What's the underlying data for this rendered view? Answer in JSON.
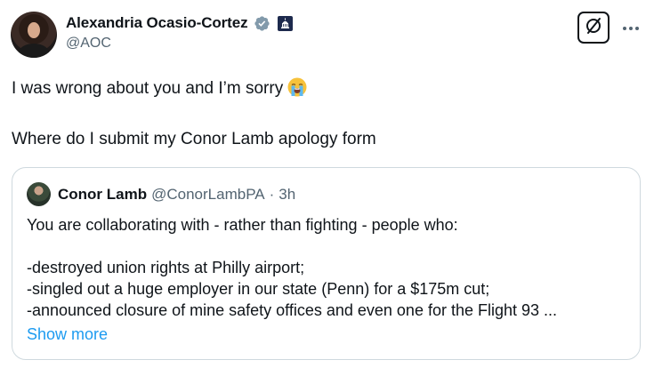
{
  "author": {
    "display_name": "Alexandria Ocasio-Cortez",
    "handle": "@AOC"
  },
  "tweet": {
    "line1": "I was wrong about you and I’m sorry",
    "line1_emoji": "loudly-crying-face",
    "line2": "Where do I submit my Conor Lamb apology form"
  },
  "quote": {
    "display_name": "Conor Lamb",
    "handle": "@ConorLambPA",
    "separator": "·",
    "time": "3h",
    "lines": [
      "You are collaborating with - rather than fighting - people who:",
      "",
      "-destroyed union rights at Philly airport;",
      "-singled out a huge employer in our state (Penn) for a $175m cut;",
      "-announced closure of mine safety offices and even one for the Flight 93 ..."
    ],
    "show_more": "Show more"
  },
  "colors": {
    "text": "#0f1419",
    "secondary": "#536471",
    "link": "#1d9bf0",
    "verified": "#829aab",
    "border": "#cfd9de"
  },
  "icons": [
    "verified-badge-icon",
    "government-badge-icon",
    "grok-icon",
    "more-options-icon"
  ]
}
